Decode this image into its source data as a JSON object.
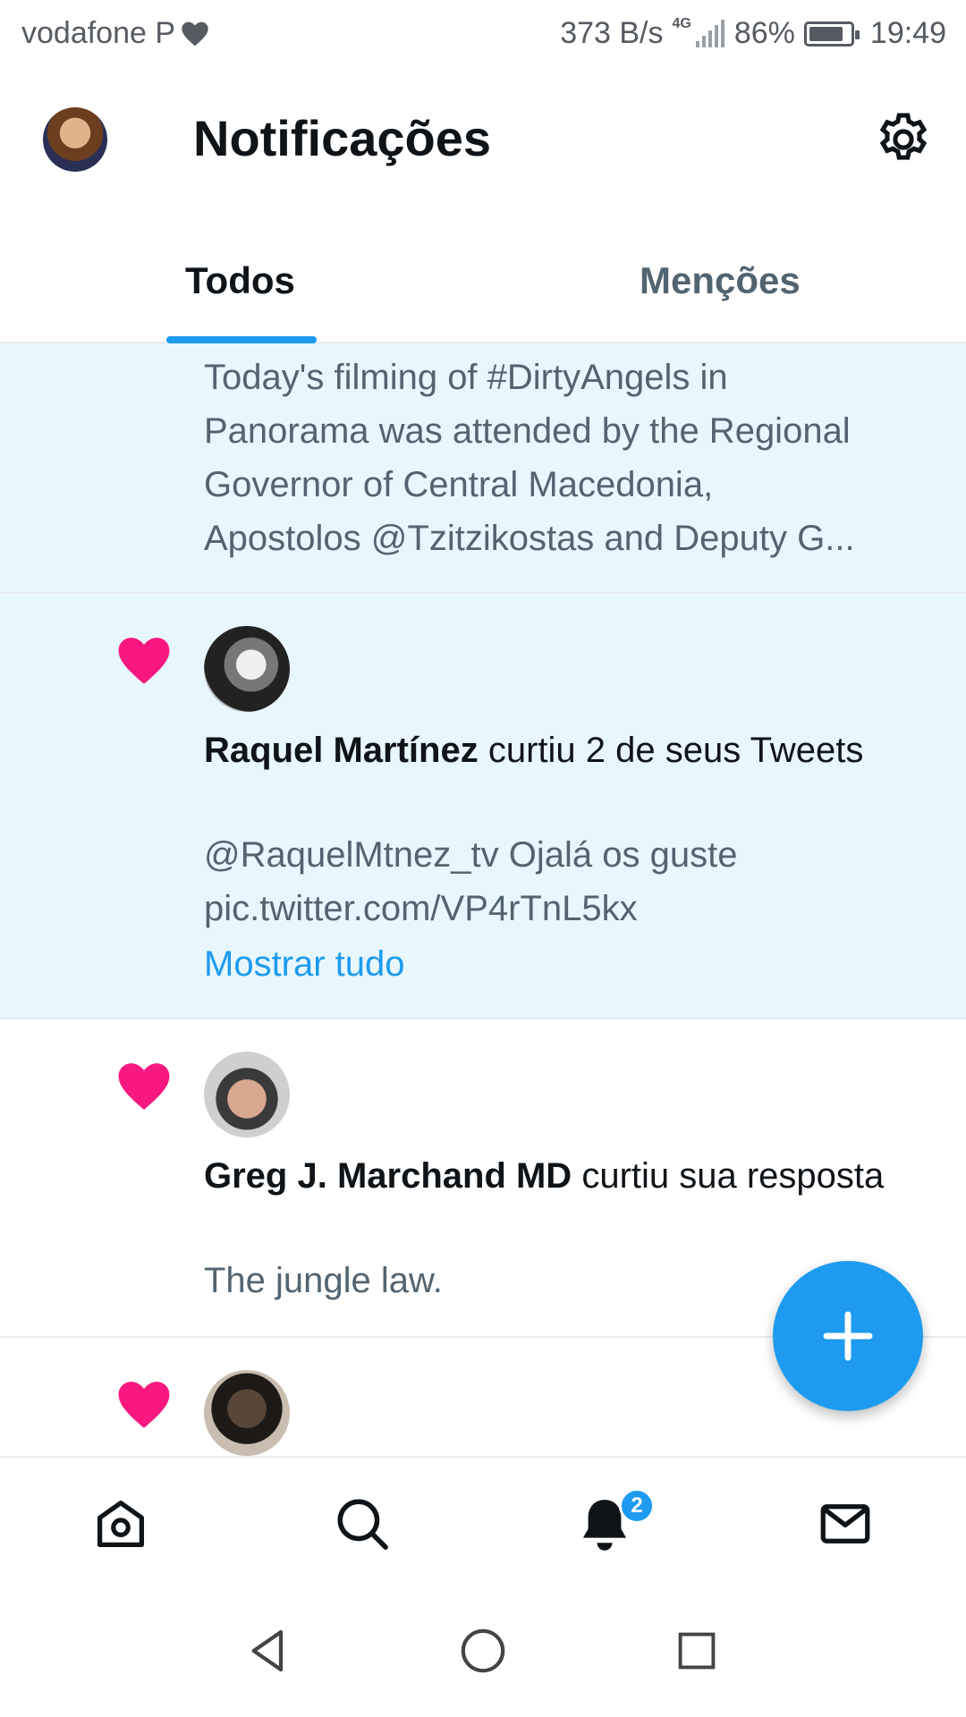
{
  "status_bar": {
    "carrier": "vodafone P",
    "net_speed": "373 B/s",
    "network_type": "4G",
    "battery": "86%",
    "time": "19:49"
  },
  "header": {
    "title": "Notificações"
  },
  "tabs": [
    {
      "label": "Todos",
      "active": true
    },
    {
      "label": "Menções",
      "active": false
    }
  ],
  "notifications": [
    {
      "tweet_lines": [
        "Today's filming of #DirtyAngels in",
        "Panorama was attended by the Regional",
        "Governor of Central Macedonia,",
        "Apostolos @Tzitzikostas and Deputy G..."
      ]
    },
    {
      "type": "like",
      "user": "Raquel Martínez",
      "action": " curtiu 2 de seus Tweets",
      "tweet_line1": "@RaquelMtnez_tv Ojalá os guste",
      "tweet_line2": "pic.twitter.com/VP4rTnL5kx",
      "show_all": "Mostrar tudo"
    },
    {
      "type": "like",
      "user": "Greg J. Marchand MD",
      "action": " curtiu sua resposta",
      "tweet_line1": "The jungle law."
    },
    {
      "type": "like"
    }
  ],
  "bottom_nav": {
    "notification_badge": "2"
  },
  "colors": {
    "accent": "#1d9bf0",
    "like": "#f91880",
    "unread_bg": "#e8f7fd"
  }
}
